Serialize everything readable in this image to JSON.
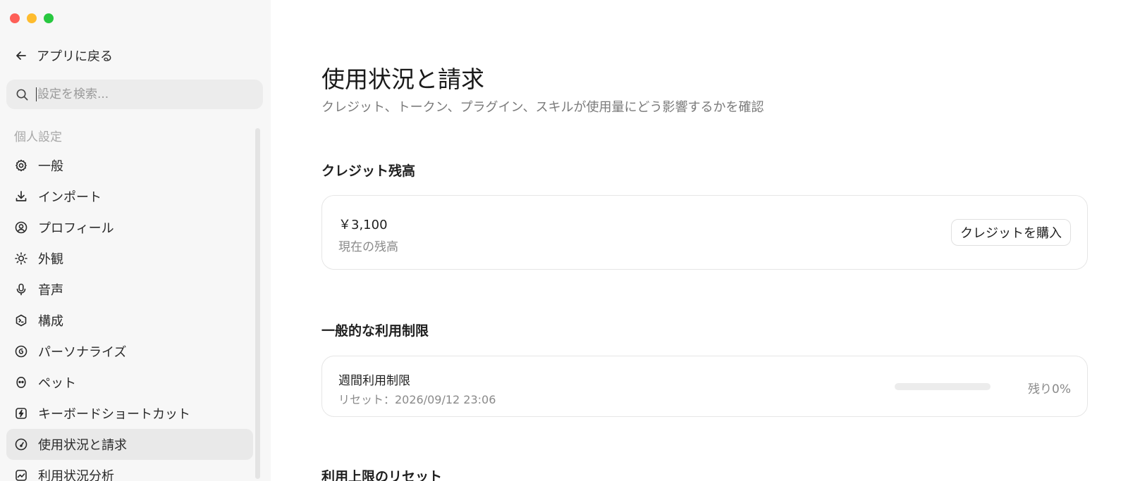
{
  "sidebar": {
    "back_label": "アプリに戻る",
    "search_placeholder": "設定を検索...",
    "section_label": "個人設定",
    "items": [
      {
        "label": "一般",
        "icon": "gear-icon"
      },
      {
        "label": "インポート",
        "icon": "download-icon"
      },
      {
        "label": "プロフィール",
        "icon": "user-circle-icon"
      },
      {
        "label": "外観",
        "icon": "sun-icon"
      },
      {
        "label": "音声",
        "icon": "microphone-icon"
      },
      {
        "label": "構成",
        "icon": "terminal-badge-icon"
      },
      {
        "label": "パーソナライズ",
        "icon": "personalize-icon"
      },
      {
        "label": "ペット",
        "icon": "pet-icon"
      },
      {
        "label": "キーボードショートカット",
        "icon": "lightning-icon"
      },
      {
        "label": "使用状況と請求",
        "icon": "gauge-icon",
        "active": true
      },
      {
        "label": "利用状況分析",
        "icon": "chart-icon"
      }
    ]
  },
  "main": {
    "title": "使用状況と請求",
    "subtitle": "クレジット、トークン、プラグイン、スキルが使用量にどう影響するかを確認",
    "credit_section": {
      "heading": "クレジット残高",
      "amount": "￥3,100",
      "amount_sub": "現在の残高",
      "buy_label": "クレジットを購入"
    },
    "limits_section": {
      "heading": "一般的な利用制限",
      "weekly_title": "週間利用制限",
      "weekly_reset": "リセット：2026/09/12 23:06",
      "remaining_label": "残り0%",
      "remaining_fraction": 0
    },
    "reset_section": {
      "heading": "利用上限のリセット"
    }
  },
  "colors": {
    "sidebar_bg": "#f7f7f7",
    "active_item_bg": "#e9e9e9",
    "traffic_red": "#fe5f57",
    "traffic_yellow": "#febc2e",
    "traffic_green": "#28c840"
  }
}
